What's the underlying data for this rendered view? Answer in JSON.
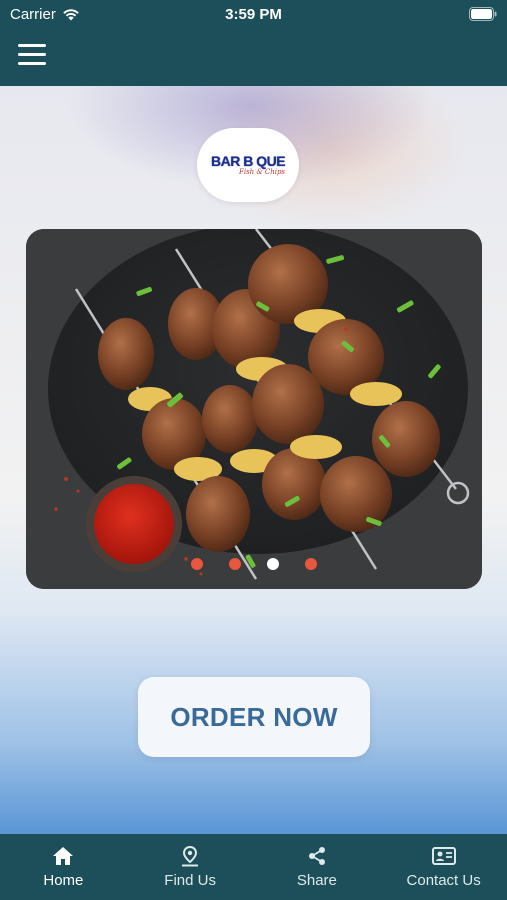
{
  "status_bar": {
    "carrier": "Carrier",
    "time": "3:59 PM"
  },
  "header": {
    "menu_icon": "hamburger-menu-icon"
  },
  "logo": {
    "title": "BAR B QUE",
    "subtitle": "Fish & Chips"
  },
  "carousel": {
    "slide_count": 4,
    "active_index": 2
  },
  "order_button": {
    "label": "ORDER NOW"
  },
  "bottom_nav": {
    "items": [
      {
        "label": "Home",
        "icon": "home-icon",
        "active": true
      },
      {
        "label": "Find Us",
        "icon": "location-pin-icon",
        "active": false
      },
      {
        "label": "Share",
        "icon": "share-icon",
        "active": false
      },
      {
        "label": "Contact Us",
        "icon": "contact-card-icon",
        "active": false
      }
    ]
  },
  "colors": {
    "bar": "#1c4f59",
    "accent_dot": "#e8573d",
    "button_text": "#3a6a99"
  }
}
